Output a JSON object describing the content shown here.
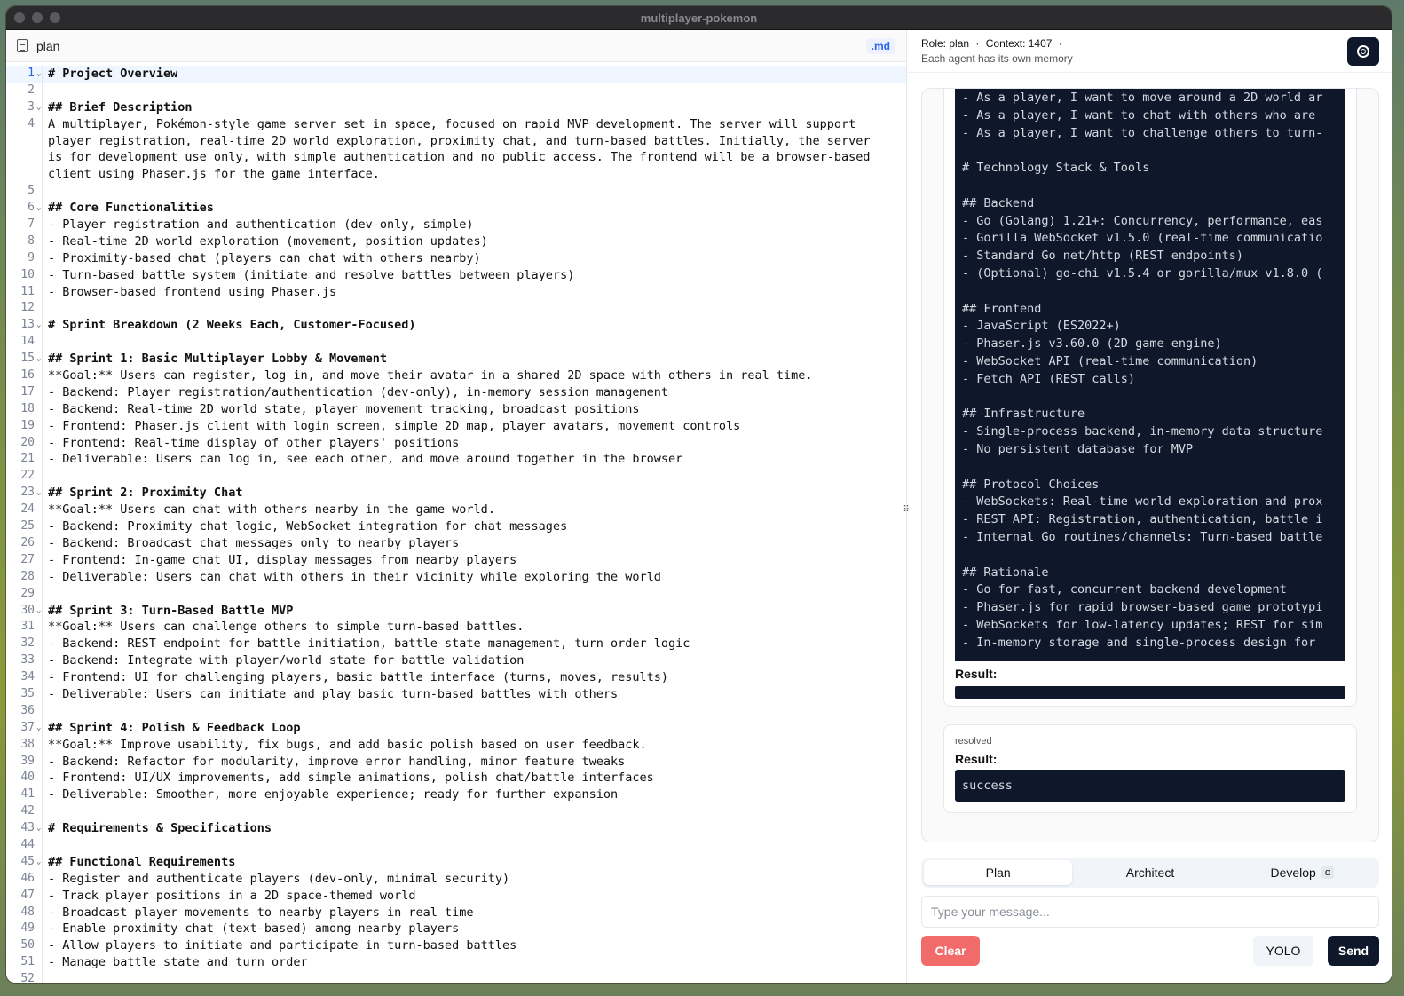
{
  "window": {
    "title": "multiplayer-pokemon"
  },
  "editor": {
    "file_name": "plan",
    "file_ext": ".md",
    "lines": [
      {
        "n": "1",
        "t": "# Project Overview",
        "h": true,
        "f": true
      },
      {
        "n": "2",
        "t": ""
      },
      {
        "n": "3",
        "t": "## Brief Description",
        "h": true,
        "f": true
      },
      {
        "n": "4",
        "t": "A multiplayer, Pokémon-style game server set in space, focused on rapid MVP development. The server will support"
      },
      {
        "n": "",
        "t": "player registration, real-time 2D world exploration, proximity chat, and turn-based battles. Initially, the server"
      },
      {
        "n": "",
        "t": "is for development use only, with simple authentication and no public access. The frontend will be a browser-based"
      },
      {
        "n": "",
        "t": "client using Phaser.js for the game interface."
      },
      {
        "n": "5",
        "t": ""
      },
      {
        "n": "6",
        "t": "## Core Functionalities",
        "h": true,
        "f": true
      },
      {
        "n": "7",
        "t": "- Player registration and authentication (dev-only, simple)"
      },
      {
        "n": "8",
        "t": "- Real-time 2D world exploration (movement, position updates)"
      },
      {
        "n": "9",
        "t": "- Proximity-based chat (players can chat with others nearby)"
      },
      {
        "n": "10",
        "t": "- Turn-based battle system (initiate and resolve battles between players)"
      },
      {
        "n": "11",
        "t": "- Browser-based frontend using Phaser.js"
      },
      {
        "n": "12",
        "t": ""
      },
      {
        "n": "13",
        "t": "# Sprint Breakdown (2 Weeks Each, Customer-Focused)",
        "h": true,
        "f": true
      },
      {
        "n": "14",
        "t": ""
      },
      {
        "n": "15",
        "t": "## Sprint 1: Basic Multiplayer Lobby & Movement",
        "h": true,
        "f": true
      },
      {
        "n": "16",
        "t": "**Goal:** Users can register, log in, and move their avatar in a shared 2D space with others in real time."
      },
      {
        "n": "17",
        "t": "- Backend: Player registration/authentication (dev-only), in-memory session management"
      },
      {
        "n": "18",
        "t": "- Backend: Real-time 2D world state, player movement tracking, broadcast positions"
      },
      {
        "n": "19",
        "t": "- Frontend: Phaser.js client with login screen, simple 2D map, player avatars, movement controls"
      },
      {
        "n": "20",
        "t": "- Frontend: Real-time display of other players' positions"
      },
      {
        "n": "21",
        "t": "- Deliverable: Users can log in, see each other, and move around together in the browser"
      },
      {
        "n": "22",
        "t": ""
      },
      {
        "n": "23",
        "t": "## Sprint 2: Proximity Chat",
        "h": true,
        "f": true
      },
      {
        "n": "24",
        "t": "**Goal:** Users can chat with others nearby in the game world."
      },
      {
        "n": "25",
        "t": "- Backend: Proximity chat logic, WebSocket integration for chat messages"
      },
      {
        "n": "26",
        "t": "- Backend: Broadcast chat messages only to nearby players"
      },
      {
        "n": "27",
        "t": "- Frontend: In-game chat UI, display messages from nearby players"
      },
      {
        "n": "28",
        "t": "- Deliverable: Users can chat with others in their vicinity while exploring the world"
      },
      {
        "n": "29",
        "t": ""
      },
      {
        "n": "30",
        "t": "## Sprint 3: Turn-Based Battle MVP",
        "h": true,
        "f": true
      },
      {
        "n": "31",
        "t": "**Goal:** Users can challenge others to simple turn-based battles."
      },
      {
        "n": "32",
        "t": "- Backend: REST endpoint for battle initiation, battle state management, turn order logic"
      },
      {
        "n": "33",
        "t": "- Backend: Integrate with player/world state for battle validation"
      },
      {
        "n": "34",
        "t": "- Frontend: UI for challenging players, basic battle interface (turns, moves, results)"
      },
      {
        "n": "35",
        "t": "- Deliverable: Users can initiate and play basic turn-based battles with others"
      },
      {
        "n": "36",
        "t": ""
      },
      {
        "n": "37",
        "t": "## Sprint 4: Polish & Feedback Loop",
        "h": true,
        "f": true
      },
      {
        "n": "38",
        "t": "**Goal:** Improve usability, fix bugs, and add basic polish based on user feedback."
      },
      {
        "n": "39",
        "t": "- Backend: Refactor for modularity, improve error handling, minor feature tweaks"
      },
      {
        "n": "40",
        "t": "- Frontend: UI/UX improvements, add simple animations, polish chat/battle interfaces"
      },
      {
        "n": "41",
        "t": "- Deliverable: Smoother, more enjoyable experience; ready for further expansion"
      },
      {
        "n": "42",
        "t": ""
      },
      {
        "n": "43",
        "t": "# Requirements & Specifications",
        "h": true,
        "f": true
      },
      {
        "n": "44",
        "t": ""
      },
      {
        "n": "45",
        "t": "## Functional Requirements",
        "h": true,
        "f": true
      },
      {
        "n": "46",
        "t": "- Register and authenticate players (dev-only, minimal security)"
      },
      {
        "n": "47",
        "t": "- Track player positions in a 2D space-themed world"
      },
      {
        "n": "48",
        "t": "- Broadcast player movements to nearby players in real time"
      },
      {
        "n": "49",
        "t": "- Enable proximity chat (text-based) among nearby players"
      },
      {
        "n": "50",
        "t": "- Allow players to initiate and participate in turn-based battles"
      },
      {
        "n": "51",
        "t": "- Manage battle state and turn order"
      },
      {
        "n": "52",
        "t": ""
      }
    ]
  },
  "panel": {
    "role": "Role: plan",
    "context": "Context: 1407",
    "sep": "·",
    "subtitle": "Each agent has its own memory",
    "code_lines": [
      "- As a player, I want to move around a 2D world ar",
      "- As a player, I want to chat with others who are ",
      "- As a player, I want to challenge others to turn-",
      "",
      "# Technology Stack & Tools",
      "",
      "## Backend",
      "- Go (Golang) 1.21+: Concurrency, performance, eas",
      "- Gorilla WebSocket v1.5.0 (real-time communicatio",
      "- Standard Go net/http (REST endpoints)",
      "- (Optional) go-chi v1.5.4 or gorilla/mux v1.8.0 (",
      "",
      "## Frontend",
      "- JavaScript (ES2022+)",
      "- Phaser.js v3.60.0 (2D game engine)",
      "- WebSocket API (real-time communication)",
      "- Fetch API (REST calls)",
      "",
      "## Infrastructure",
      "- Single-process backend, in-memory data structure",
      "- No persistent database for MVP",
      "",
      "## Protocol Choices",
      "- WebSockets: Real-time world exploration and prox",
      "- REST API: Registration, authentication, battle i",
      "- Internal Go routines/channels: Turn-based battle",
      "",
      "## Rationale",
      "- Go for fast, concurrent backend development",
      "- Phaser.js for rapid browser-based game prototypi",
      "- WebSockets for low-latency updates; REST for sim",
      "- In-memory storage and single-process design for "
    ],
    "result_label": "Result:",
    "resolved_label": "resolved",
    "result_value": "success",
    "tabs": [
      {
        "label": "Plan"
      },
      {
        "label": "Architect"
      },
      {
        "label": "Develop",
        "badge": "α"
      }
    ],
    "input_placeholder": "Type your message...",
    "clear_label": "Clear",
    "yolo_label": "YOLO",
    "send_label": "Send"
  }
}
